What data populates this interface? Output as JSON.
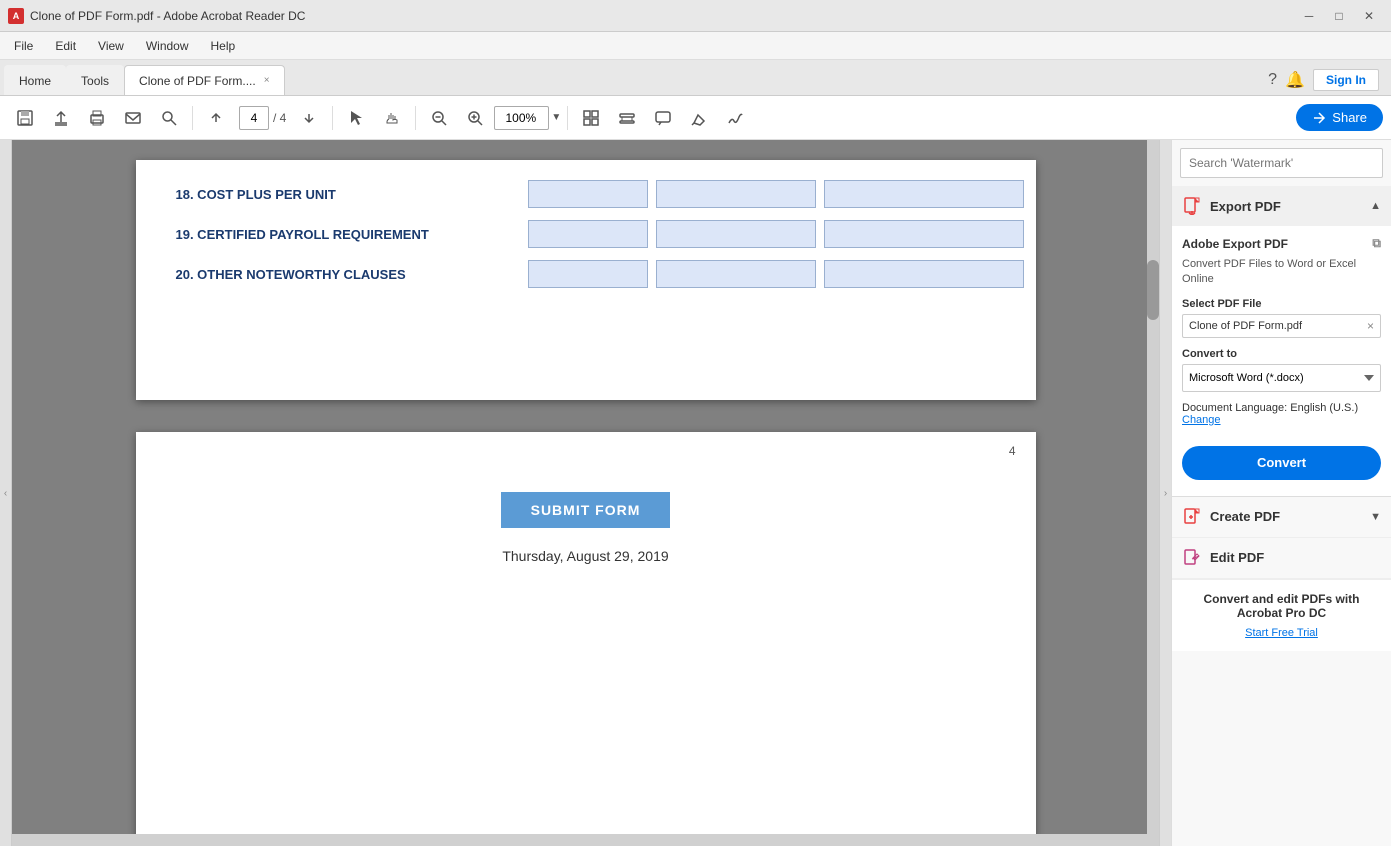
{
  "titleBar": {
    "title": "Clone of PDF Form.pdf - Adobe Acrobat Reader DC",
    "iconLabel": "A",
    "minimizeLabel": "─",
    "maximizeLabel": "□",
    "closeLabel": "✕"
  },
  "menuBar": {
    "items": [
      "File",
      "Edit",
      "View",
      "Window",
      "Help"
    ]
  },
  "tabs": {
    "home": "Home",
    "tools": "Tools",
    "active": "Clone of PDF Form....",
    "closeLabel": "×"
  },
  "tabBarRight": {
    "helpLabel": "?",
    "notifyLabel": "🔔",
    "signInLabel": "Sign In"
  },
  "toolbar": {
    "saveLabel": "💾",
    "uploadLabel": "⬆",
    "printLabel": "🖨",
    "mailLabel": "✉",
    "searchLabel": "🔍",
    "prevPageLabel": "⬆",
    "nextPageLabel": "⬇",
    "currentPage": "4",
    "totalPages": "4",
    "selectLabel": "↖",
    "handLabel": "✋",
    "zoomOutLabel": "−",
    "zoomInLabel": "+",
    "zoomValue": "100%",
    "toolsLabel": "⊞",
    "stampLabel": "T",
    "commentLabel": "💬",
    "highlightLabel": "✏",
    "signLabel": "✍",
    "shareLabel": "Share"
  },
  "pdfContent": {
    "page1": {
      "sections": [
        {
          "label": "18. COST PLUS PER UNIT",
          "fields": [
            "sm",
            "md",
            "lg"
          ]
        },
        {
          "label": "19. CERTIFIED PAYROLL REQUIREMENT",
          "fields": [
            "sm",
            "md",
            "lg"
          ]
        },
        {
          "label": "20. OTHER NOTEWORTHY CLAUSES",
          "fields": [
            "sm",
            "md",
            "lg"
          ]
        }
      ]
    },
    "page2": {
      "pageNumber": "4",
      "submitLabel": "SUBMIT FORM",
      "dateText": "Thursday, August 29, 2019"
    }
  },
  "rightPanel": {
    "searchPlaceholder": "Search 'Watermark'",
    "exportPDF": {
      "sectionTitle": "Export PDF",
      "chevron": "▲",
      "adobeTitle": "Adobe Export PDF",
      "desc": "Convert PDF Files to Word or Excel Online",
      "selectFileLabel": "Select PDF File",
      "fileName": "Clone of PDF Form.pdf",
      "closeLabel": "×",
      "convertToLabel": "Convert to",
      "convertToValue": "Microsoft Word (*.docx)",
      "docLangLabel": "Document Language:",
      "docLangValue": "English (U.S.)",
      "changeLinkLabel": "Change",
      "convertBtnLabel": "Convert"
    },
    "createPDF": {
      "sectionTitle": "Create PDF",
      "chevron": "▼"
    },
    "editPDF": {
      "sectionTitle": "Edit PDF",
      "chevron": ""
    },
    "promo": {
      "title": "Convert and edit PDFs with Acrobat Pro DC",
      "freeTrialLabel": "Start Free Trial"
    }
  }
}
